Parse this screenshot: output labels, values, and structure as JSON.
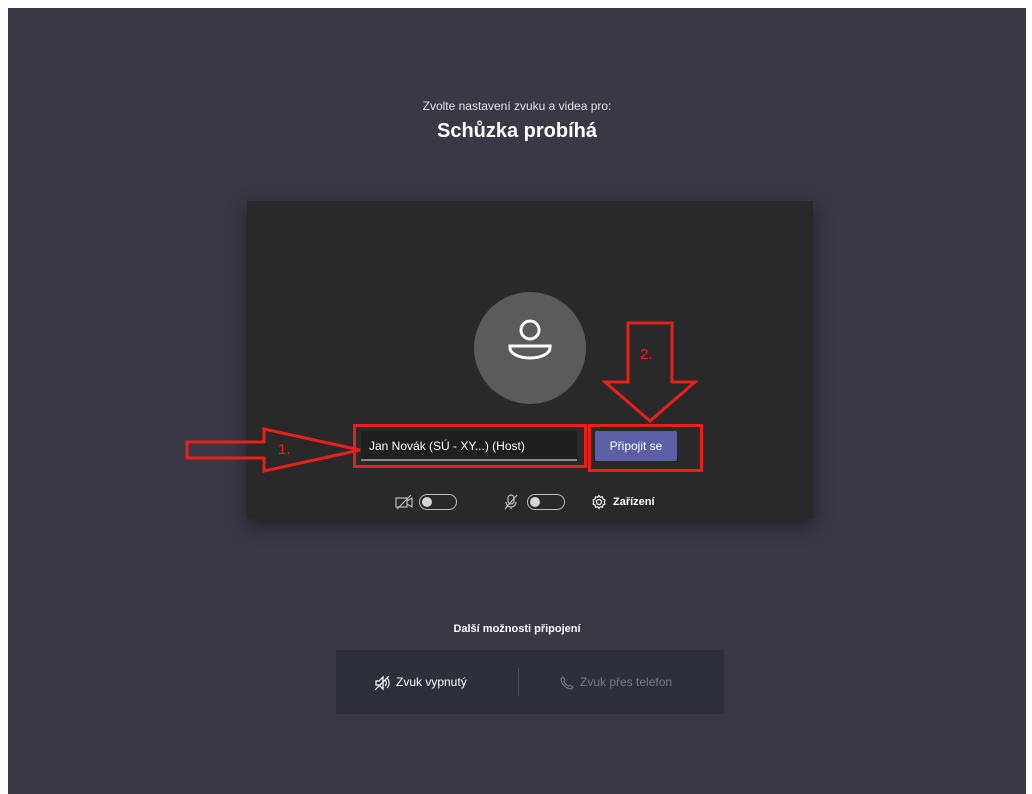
{
  "prejoin": {
    "subtitle": "Zvolte nastavení zvuku a videa pro:",
    "meeting_title": "Schůzka probíhá",
    "name_value": "Jan Novák (SÚ - XY...) (Host)",
    "join_label": "Připojit se",
    "camera_enabled": false,
    "mic_enabled": false,
    "devices_label": "Zařízení"
  },
  "annotations": {
    "step1": "1.",
    "step2": "2.",
    "color": "#e8201c"
  },
  "more_options": {
    "title": "Další možnosti připojení",
    "audio_off_label": "Zvuk vypnutý",
    "phone_label": "Zvuk přes telefon"
  },
  "colors": {
    "background": "#393844",
    "preview": "#292929",
    "accent": "#5b5fa6"
  }
}
